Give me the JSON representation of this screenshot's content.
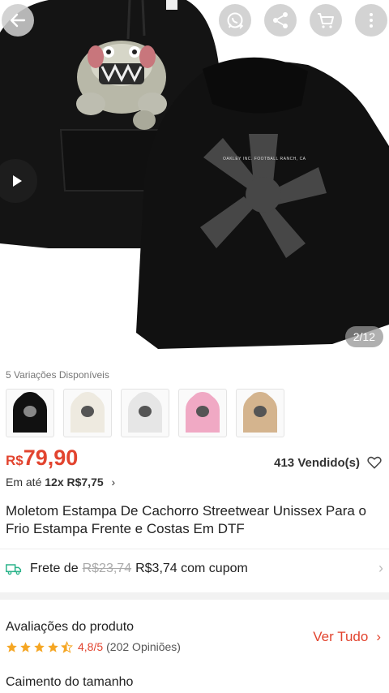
{
  "gallery": {
    "counter": "2/12",
    "back_print": "OAKLEY INC. FOOTBALL RANCH, CA",
    "buttons": [
      "back-arrow-icon",
      "whatsapp-icon",
      "share-icon",
      "cart-icon",
      "more-vertical-icon"
    ]
  },
  "variations": {
    "label": "5 Variações Disponíveis",
    "colors": [
      "#111111",
      "#eeeae0",
      "#e6e6e6",
      "#f0a9c4",
      "#d4b48e"
    ]
  },
  "price": {
    "currency": "R$",
    "value": "79,90",
    "sold": "413 Vendido(s)",
    "installments_prefix": "Em até",
    "installments_bold": "12x R$7,75",
    "installments_chevron": "›"
  },
  "product": {
    "title": "Moletom Estampa De Cachorro Streetwear Unissex Para o Frio Estampa Frente e Costas Em DTF"
  },
  "shipping": {
    "prefix": "Frete de",
    "old_price": "R$23,74",
    "new_text": "R$3,74 com cupom",
    "chevron": "›"
  },
  "reviews": {
    "title": "Avaliações do produto",
    "rating": "4,8/5",
    "count": "(202 Opiniões)",
    "see_all": "Ver Tudo",
    "chevron": "›",
    "stars": 4.8
  },
  "fit": {
    "title": "Caimento do tamanho"
  },
  "colors": {
    "accent": "#e2442f",
    "star": "#f5a623",
    "ship_icon": "#2bb38a"
  }
}
